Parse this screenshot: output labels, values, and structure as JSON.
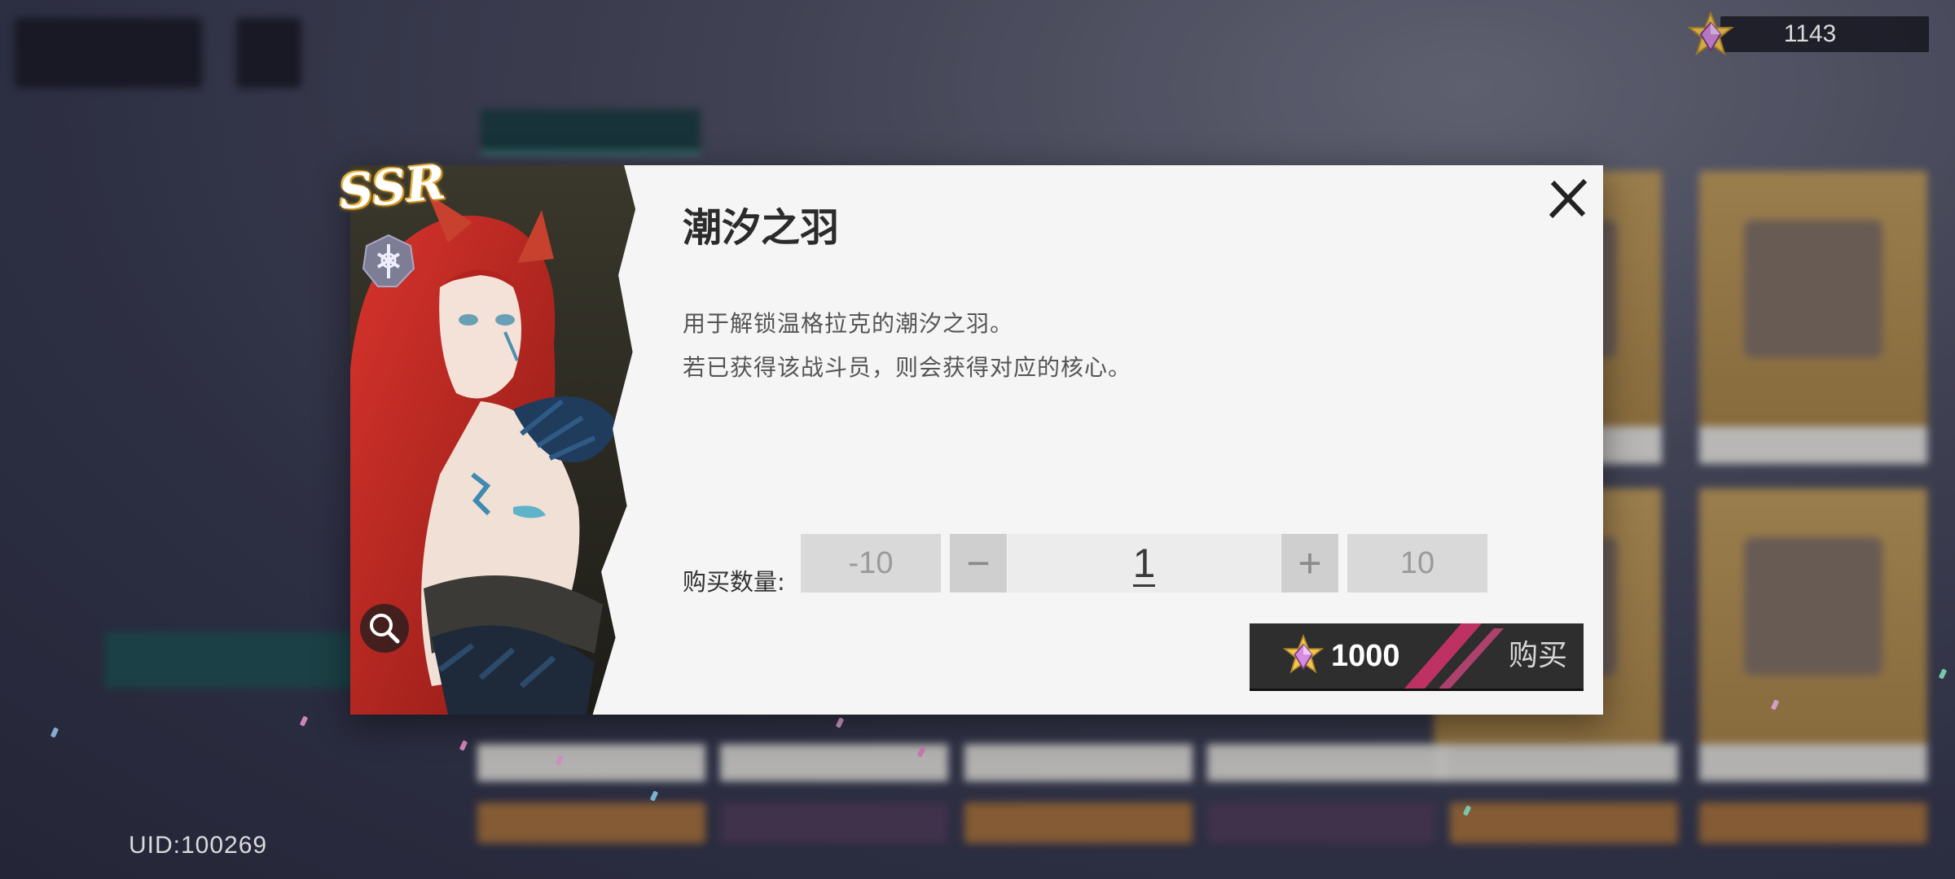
{
  "currency": {
    "icon": "star-gem-icon",
    "amount": "1143"
  },
  "uid": "UID:100269",
  "dialog": {
    "rarity": "SSR",
    "title": "潮汐之羽",
    "description": [
      "用于解锁温格拉克的潮汐之羽。",
      "若已获得该战斗员，则会获得对应的核心。"
    ],
    "quantity": {
      "label": "购买数量:",
      "minus_ten": "-10",
      "minus": "−",
      "value": "1",
      "plus": "+",
      "plus_ten": "10"
    },
    "buy": {
      "price": "1000",
      "label": "购买",
      "icon": "star-gem-icon"
    },
    "icons": {
      "close": "close-icon",
      "zoom": "magnifier-icon",
      "faction": "faction-emblem-icon"
    }
  },
  "colors": {
    "accent_teal": "#4ac2b7",
    "dialog_bg": "#f5f5f5",
    "buy_button": "#2e2e2e",
    "currency_gem": "#d9a7e8"
  }
}
